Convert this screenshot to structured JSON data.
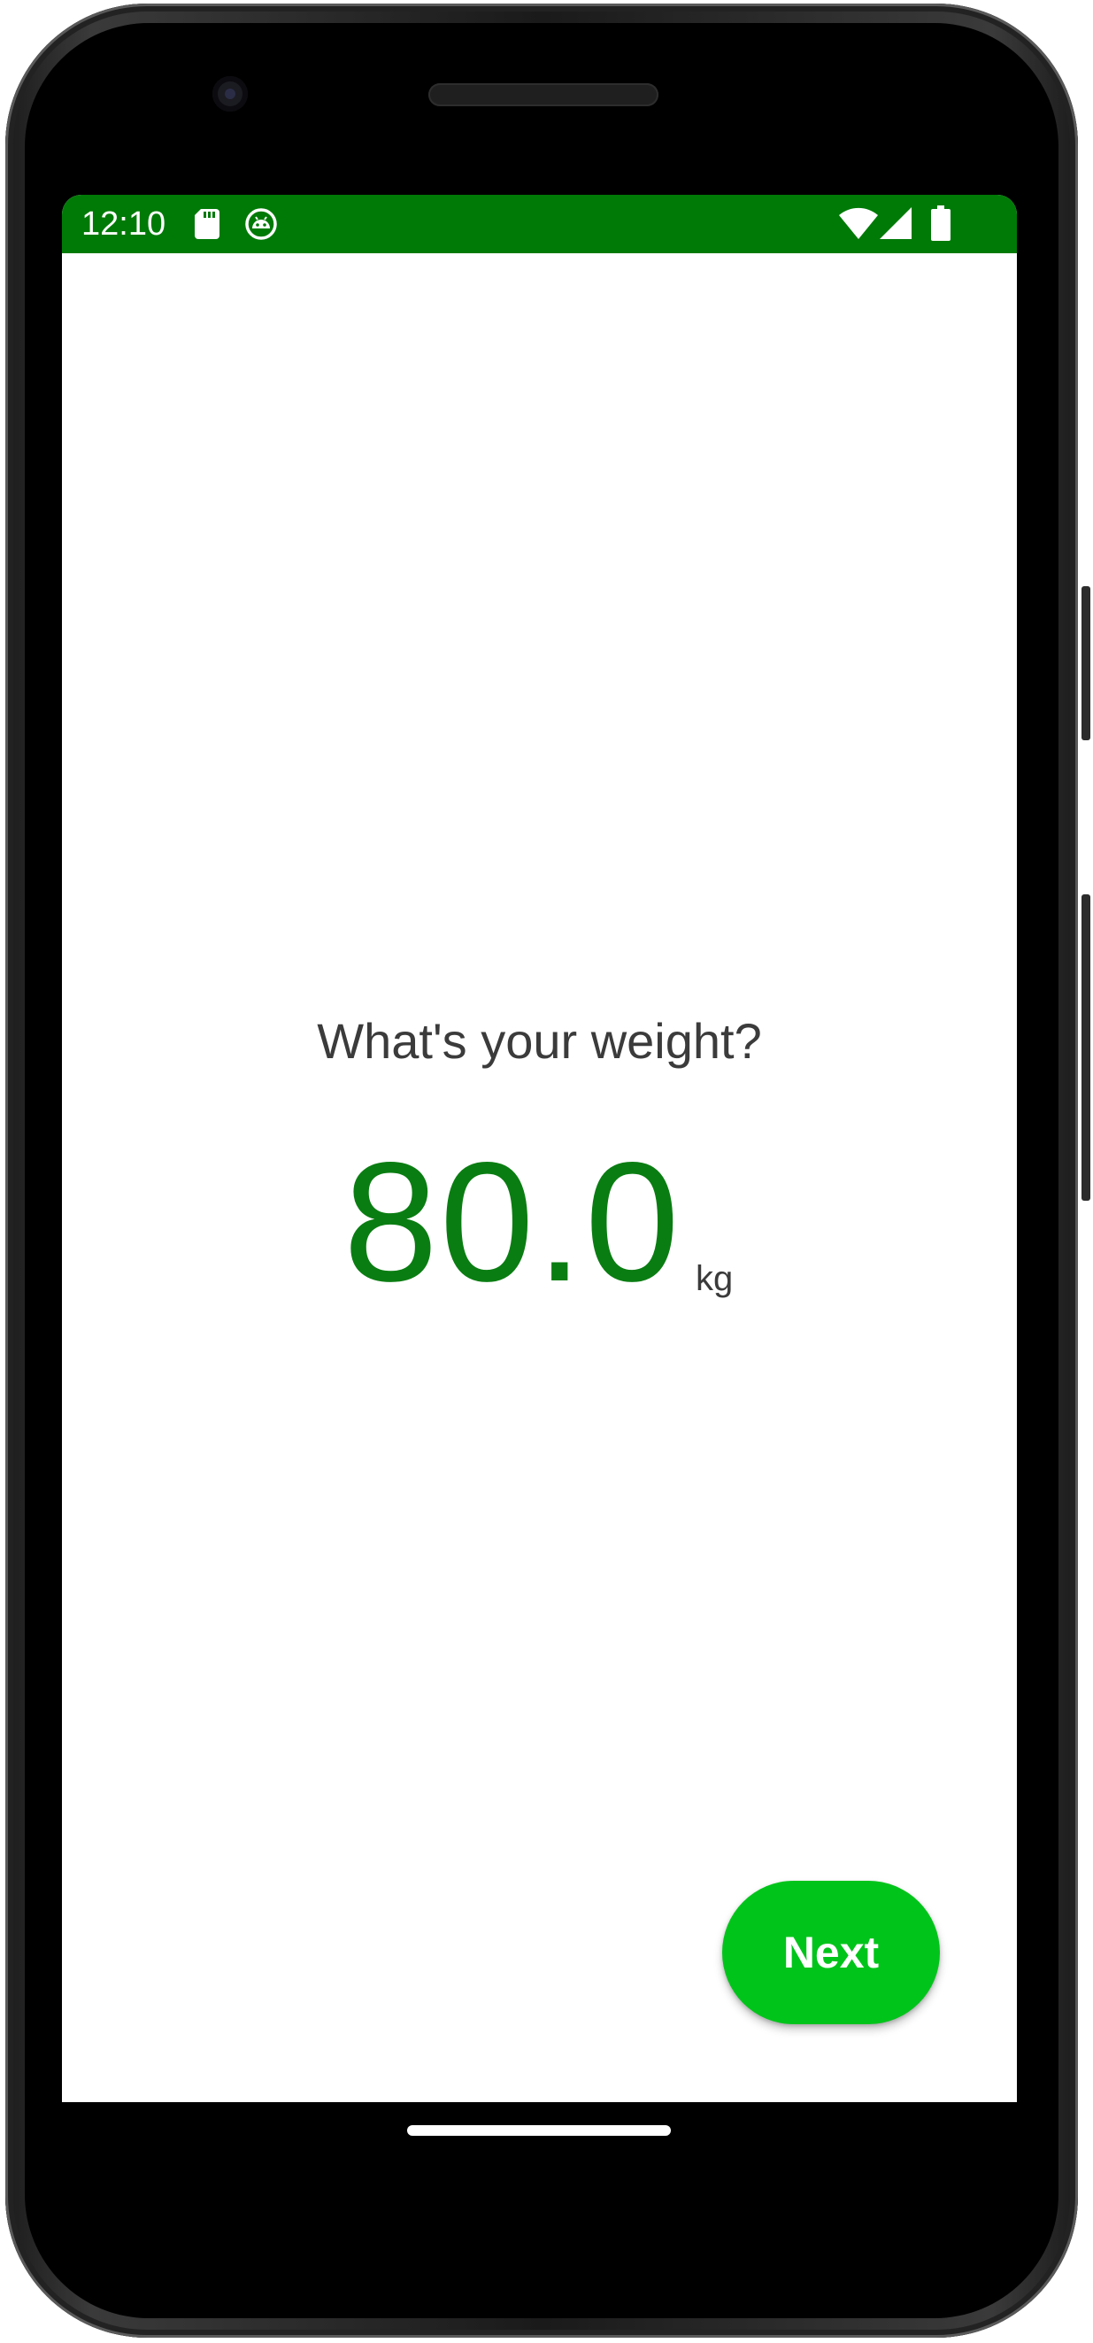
{
  "status_bar": {
    "time": "12:10",
    "icons": [
      "sd-card-icon",
      "android-debug-icon",
      "wifi-icon",
      "cell-signal-icon",
      "battery-icon"
    ],
    "background_color": "#007a07"
  },
  "onboarding": {
    "question": "What's your weight?",
    "weight_value": "80.0",
    "weight_unit": "kg",
    "value_color": "#0a7d12"
  },
  "actions": {
    "next_label": "Next",
    "next_color": "#00c41a"
  }
}
